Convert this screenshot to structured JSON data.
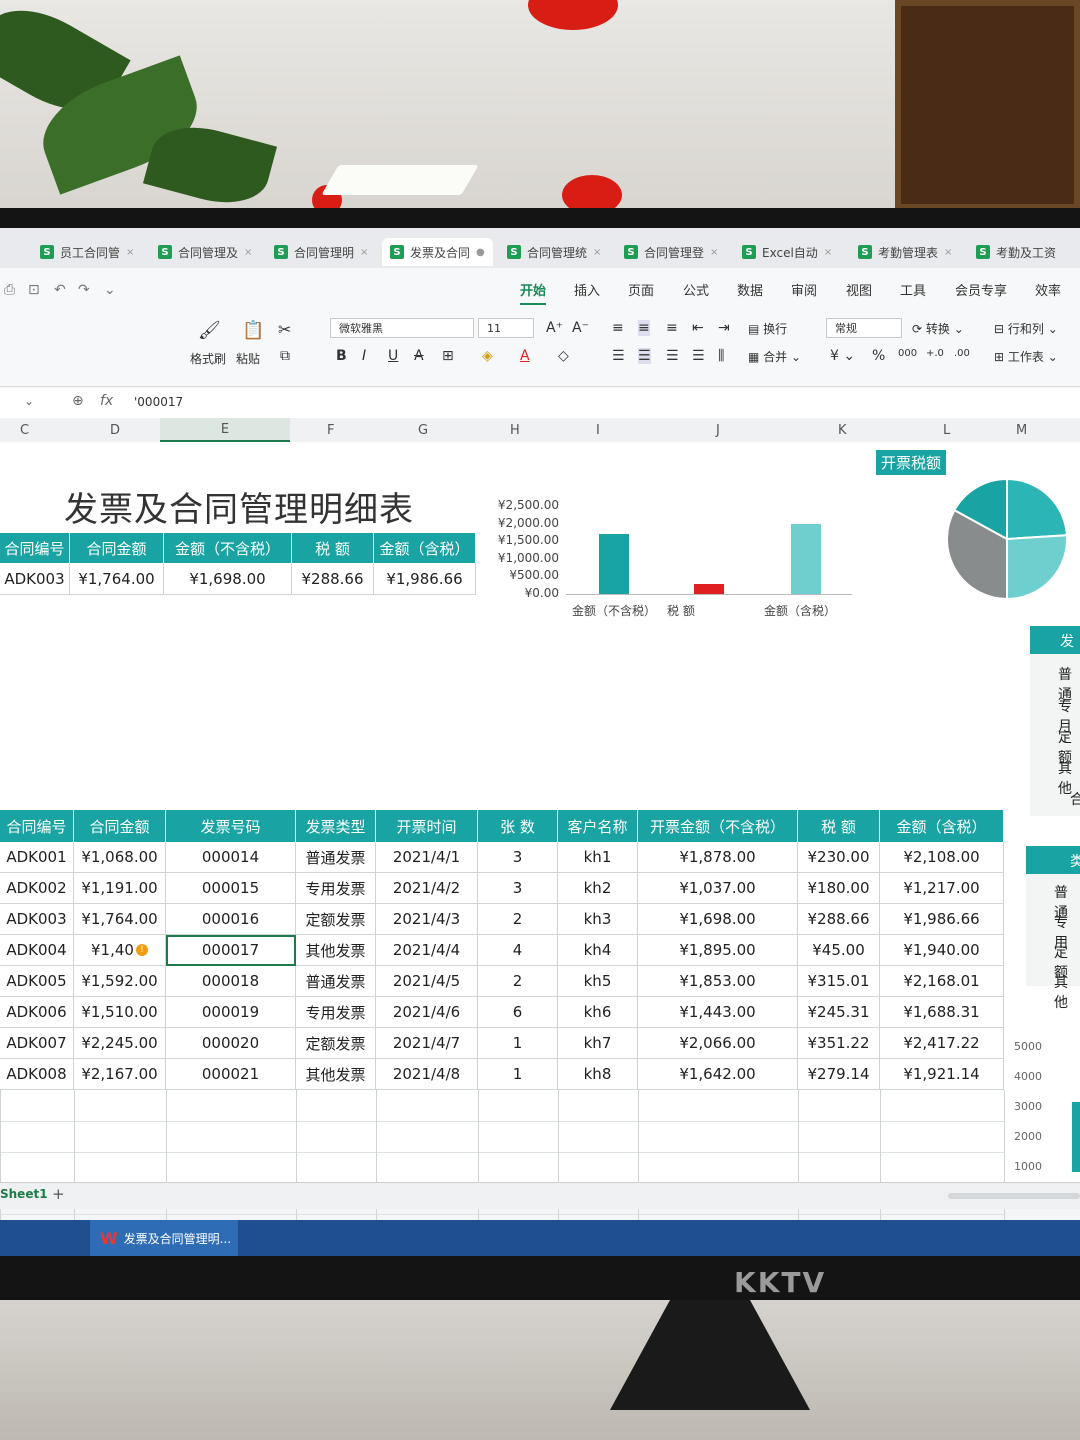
{
  "window": {
    "tabs": [
      {
        "label": "员工合同管"
      },
      {
        "label": "合同管理及"
      },
      {
        "label": "合同管理明"
      },
      {
        "label": "发票及合同"
      },
      {
        "label": "合同管理统"
      },
      {
        "label": "合同管理登"
      },
      {
        "label": "Excel自动"
      },
      {
        "label": "考勤管理表"
      },
      {
        "label": "考勤及工资"
      }
    ],
    "menu": [
      "开始",
      "插入",
      "页面",
      "公式",
      "数据",
      "审阅",
      "视图",
      "工具",
      "会员专享",
      "效率"
    ],
    "active_menu": "开始"
  },
  "ribbon": {
    "format_painter": "格式刷",
    "paste": "粘贴",
    "font_name": "微软雅黑",
    "font_size": "11",
    "wrap": "换行",
    "merge": "合并",
    "number_format": "常规",
    "convert": "转换",
    "row_col": "行和列",
    "worksheet": "工作表",
    "bold": "B",
    "italic": "I",
    "underline": "U"
  },
  "formula_bar": {
    "fx": "fx",
    "value": "'000017"
  },
  "columns": [
    "C",
    "D",
    "E",
    "F",
    "G",
    "H",
    "I",
    "J",
    "K",
    "L",
    "M"
  ],
  "sheet": {
    "title": "发票及合同管理明细表",
    "badge": "开票税额",
    "summary": {
      "headers": [
        "合同编号",
        "合同金额",
        "金额（不含税）",
        "税 额",
        "金额（含税）"
      ],
      "row": [
        "ADK003",
        "¥1,764.00",
        "¥1,698.00",
        "¥288.66",
        "¥1,986.66"
      ]
    },
    "main_headers": [
      "合同编号",
      "合同金额",
      "发票号码",
      "发票类型",
      "开票时间",
      "张 数",
      "客户名称",
      "开票金额（不含税）",
      "税 额",
      "金额（含税）"
    ],
    "rows": [
      [
        "ADK001",
        "¥1,068.00",
        "000014",
        "普通发票",
        "2021/4/1",
        "3",
        "kh1",
        "¥1,878.00",
        "¥230.00",
        "¥2,108.00"
      ],
      [
        "ADK002",
        "¥1,191.00",
        "000015",
        "专用发票",
        "2021/4/2",
        "3",
        "kh2",
        "¥1,037.00",
        "¥180.00",
        "¥1,217.00"
      ],
      [
        "ADK003",
        "¥1,764.00",
        "000016",
        "定额发票",
        "2021/4/3",
        "2",
        "kh3",
        "¥1,698.00",
        "¥288.66",
        "¥1,986.66"
      ],
      [
        "ADK004",
        "¥1,40",
        "000017",
        "其他发票",
        "2021/4/4",
        "4",
        "kh4",
        "¥1,895.00",
        "¥45.00",
        "¥1,940.00"
      ],
      [
        "ADK005",
        "¥1,592.00",
        "000018",
        "普通发票",
        "2021/4/5",
        "2",
        "kh5",
        "¥1,853.00",
        "¥315.01",
        "¥2,168.01"
      ],
      [
        "ADK006",
        "¥1,510.00",
        "000019",
        "专用发票",
        "2021/4/6",
        "6",
        "kh6",
        "¥1,443.00",
        "¥245.31",
        "¥1,688.31"
      ],
      [
        "ADK007",
        "¥2,245.00",
        "000020",
        "定额发票",
        "2021/4/7",
        "1",
        "kh7",
        "¥2,066.00",
        "¥351.22",
        "¥2,417.22"
      ],
      [
        "ADK008",
        "¥2,167.00",
        "000021",
        "其他发票",
        "2021/4/8",
        "1",
        "kh8",
        "¥1,642.00",
        "¥279.14",
        "¥1,921.14"
      ]
    ],
    "side_panel": {
      "header_1": "发",
      "items_1": [
        "普通",
        "专月",
        "定额",
        "其他",
        "合"
      ],
      "header_2": "类",
      "items_2": [
        "普通",
        "专用",
        "定额",
        "其他"
      ],
      "axis": [
        "5000",
        "4000",
        "3000",
        "2000",
        "1000"
      ]
    }
  },
  "chart_data": {
    "type": "bar",
    "categories": [
      "金额（不含税）",
      "税 额",
      "金额（含税）"
    ],
    "values": [
      1698.0,
      288.66,
      1986.66
    ],
    "yticks": [
      "¥2,500.00",
      "¥2,000.00",
      "¥1,500.00",
      "¥1,000.00",
      "¥500.00",
      "¥0.00"
    ],
    "ylim": [
      0,
      2500
    ],
    "colors": [
      "#1aa3a3",
      "#e02020",
      "#6fcfcf"
    ]
  },
  "pie_data": {
    "type": "pie",
    "colors": [
      "#1aa3a3",
      "#6fcfcf",
      "#888c8c",
      "#2bb5b5"
    ]
  },
  "footer": {
    "sheet_tab": "Sheet1",
    "add": "+",
    "taskbar_label": "发票及合同管理明..."
  },
  "monitor_brand": "KKTV"
}
